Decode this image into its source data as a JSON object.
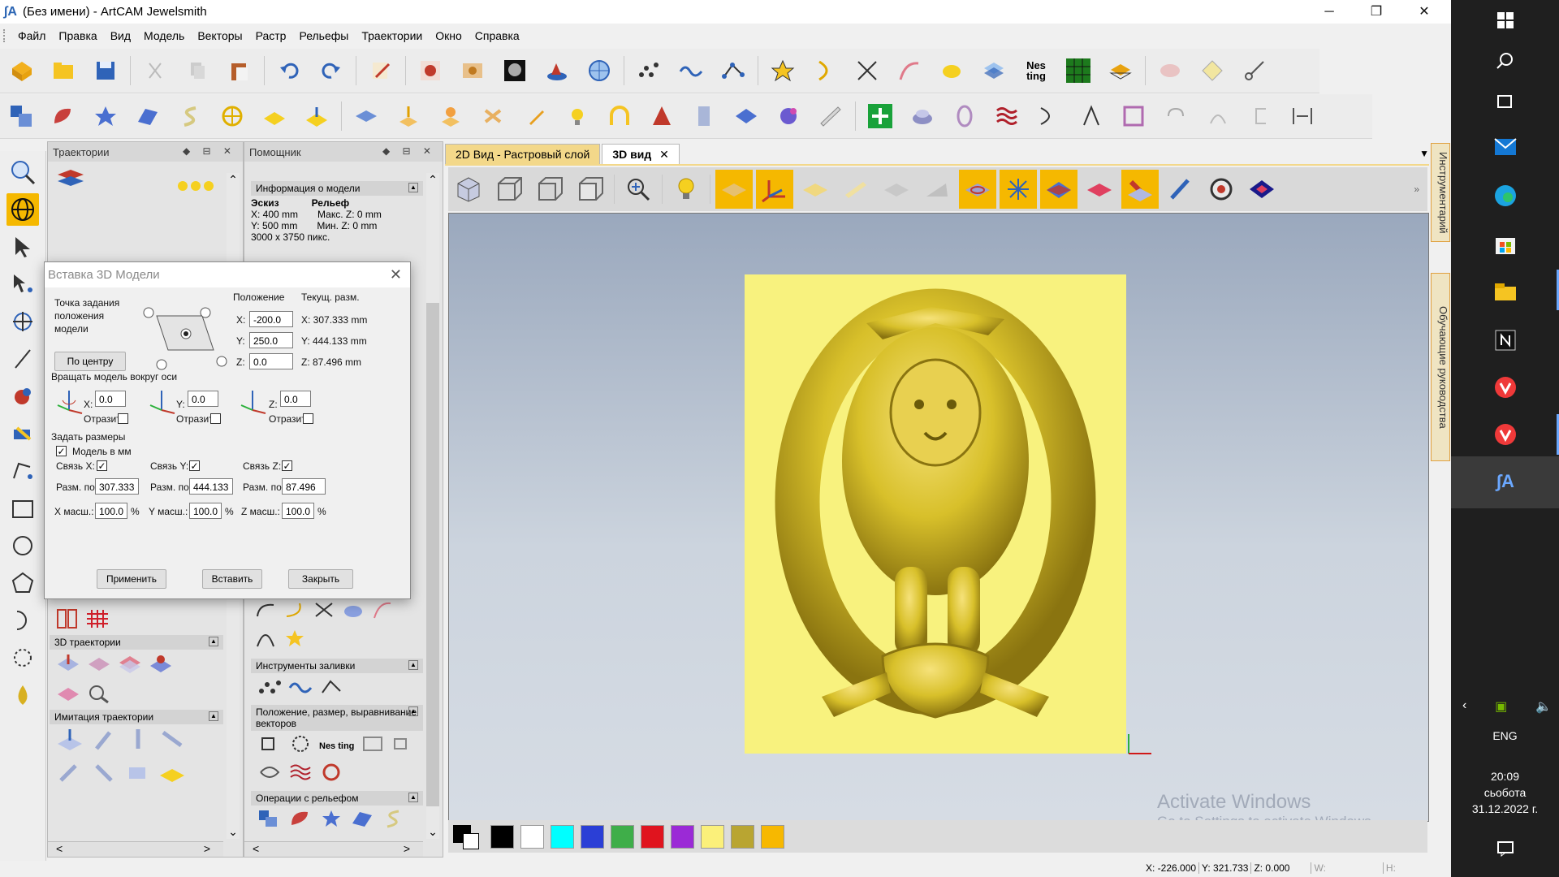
{
  "window": {
    "title": "(Без имени) - ArtCAM Jewelsmith",
    "app_icon": "artcam-logo-icon"
  },
  "menu": [
    "Файл",
    "Правка",
    "Вид",
    "Модель",
    "Векторы",
    "Растр",
    "Рельефы",
    "Траектории",
    "Окно",
    "Справка"
  ],
  "trajectories_panel": {
    "title": "Траектории",
    "sections": {
      "three_d": "3D траектории",
      "simulation": "Имитация траектории"
    }
  },
  "assistant_panel": {
    "title": "Помощник",
    "model_info": {
      "header": "Информация о модели",
      "col_sketch": "Эскиз",
      "col_relief": "Рельеф",
      "x_size": "X: 400 mm",
      "y_size": "Y: 500 mm",
      "max_z": "Макс. Z: 0 mm",
      "min_z": "Мин. Z: 0 mm",
      "pixels": "3000 x 3750 пикс."
    },
    "sections": {
      "fill_tools": "Инструменты заливки",
      "position_tools": "Положение, размер, выравнивание векторов",
      "relief_ops": "Операции с рельефом"
    },
    "nesting_label": "Nes ting"
  },
  "dialog": {
    "title": "Вставка 3D Модели",
    "anchor_label": "Точка задания положения модели",
    "center_button": "По центру",
    "position_header": "Положение",
    "current_size_header": "Текущ. разм.",
    "x_label": "X:",
    "y_label": "Y:",
    "z_label": "Z:",
    "pos_x": "-200.0",
    "pos_y": "250.0",
    "pos_z": "0.0",
    "cur_x": "X: 307.333 mm",
    "cur_y": "Y: 444.133 mm",
    "cur_z": "Z: 87.496 mm",
    "rotate_label": "Вращать модель вокруг оси",
    "rot_x": "0.0",
    "rot_y": "0.0",
    "rot_z": "0.0",
    "mirror_label": "Отразит",
    "size_label": "Задать размеры",
    "model_in_mm": "Модель в мм",
    "link_x": "Связь X:",
    "link_y": "Связь Y:",
    "link_z": "Связь Z:",
    "size_by": "Разм. по",
    "size_x": "307.333",
    "size_y": "444.133",
    "size_z": "87.496",
    "x_scale_label": "X масш.:",
    "y_scale_label": "Y масш.:",
    "z_scale_label": "Z масш.:",
    "scale_x": "100.0",
    "scale_y": "100.0",
    "scale_z": "100.0",
    "percent": "%",
    "apply_button": "Применить",
    "insert_button": "Вставить",
    "close_button": "Закрыть"
  },
  "tabs": [
    {
      "label": "2D Вид - Растровый слой",
      "active": false
    },
    {
      "label": "3D вид",
      "active": true
    }
  ],
  "side_tabs": {
    "tools": "Инструментарий",
    "tutorials": "Обучающие руководства"
  },
  "palette": [
    "#000000",
    "#ffffff",
    "#00ffff",
    "#2b3fd6",
    "#3fae49",
    "#e0141e",
    "#9b2ad6",
    "#fbf07a",
    "#b9a531",
    "#f7b800"
  ],
  "status": {
    "x": "X: -226.000",
    "y": "Y: 321.733",
    "z": "Z: 0.000",
    "w": "W:",
    "h": "H:"
  },
  "watermark": {
    "line1": "Activate Windows",
    "line2": "Go to Settings to activate Windows."
  },
  "taskbar": {
    "language": "ENG",
    "time": "20:09",
    "day": "сьобота",
    "date": "31.12.2022 г."
  },
  "colors": {
    "accent_orange": "#f7b800",
    "relief_yellow": "#d8c02a",
    "taskbar_bg": "#1f1f1f"
  }
}
